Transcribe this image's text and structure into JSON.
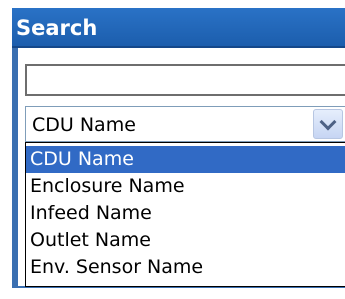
{
  "header": {
    "title": "Search"
  },
  "search": {
    "value": "",
    "placeholder": ""
  },
  "select": {
    "selected_label": "CDU Name",
    "options": [
      {
        "label": "CDU Name",
        "highlighted": true
      },
      {
        "label": "Enclosure Name",
        "highlighted": false
      },
      {
        "label": "Infeed Name",
        "highlighted": false
      },
      {
        "label": "Outlet Name",
        "highlighted": false
      },
      {
        "label": "Env. Sensor Name",
        "highlighted": false
      }
    ]
  },
  "colors": {
    "header_bg": "#1f63b3",
    "highlight_bg": "#316ac5",
    "frame_border": "#3a6fb1"
  },
  "icons": {
    "dropdown_button": "chevron-down-icon"
  }
}
